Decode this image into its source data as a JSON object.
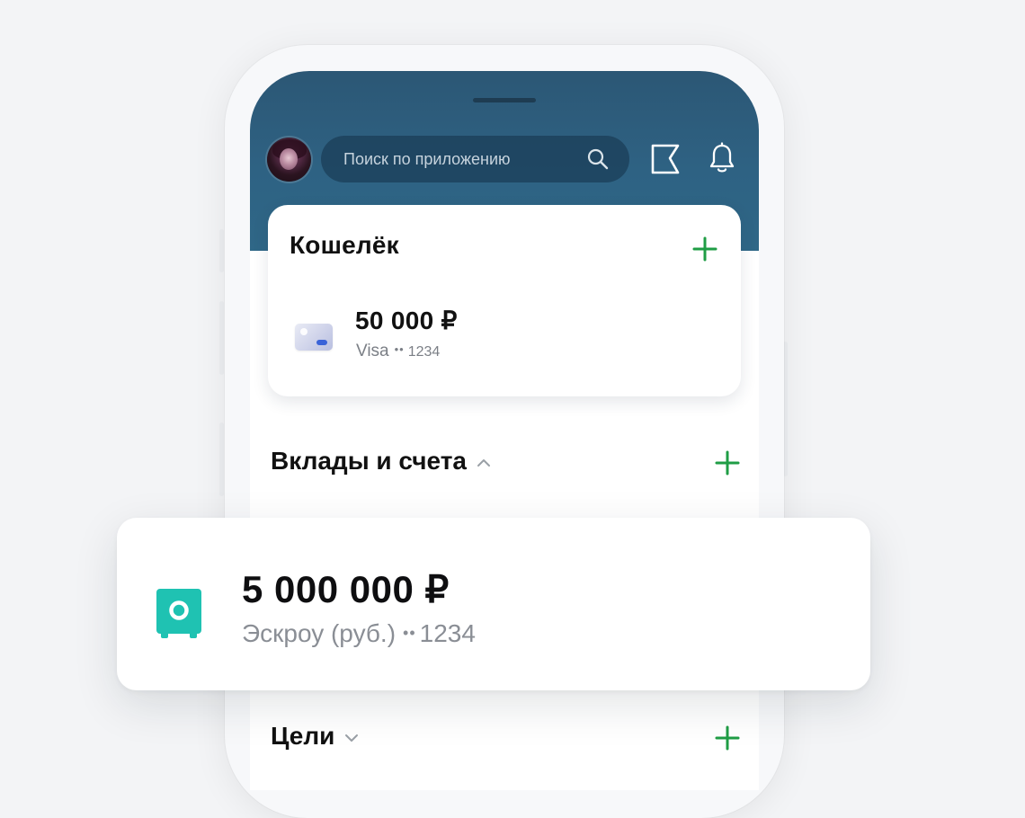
{
  "search": {
    "placeholder": "Поиск по приложению"
  },
  "wallet": {
    "title": "Кошелёк",
    "card": {
      "amount": "50 000 ₽",
      "brand": "Visa",
      "dots": "••",
      "last4": "1234"
    }
  },
  "sections": {
    "deposits": {
      "title": "Вклады и счета",
      "chevron": "chevron-up-icon"
    },
    "goals": {
      "title": "Цели",
      "chevron": "chevron-down-icon"
    }
  },
  "account": {
    "amount": "5 000 000 ₽",
    "name": "Эскроу (руб.)",
    "dots": "••",
    "last4": "1234",
    "icon": "safe-icon"
  },
  "colors": {
    "header": "#2e6283",
    "accent_green": "#1f9d45",
    "safe_teal": "#1fc2b2"
  }
}
